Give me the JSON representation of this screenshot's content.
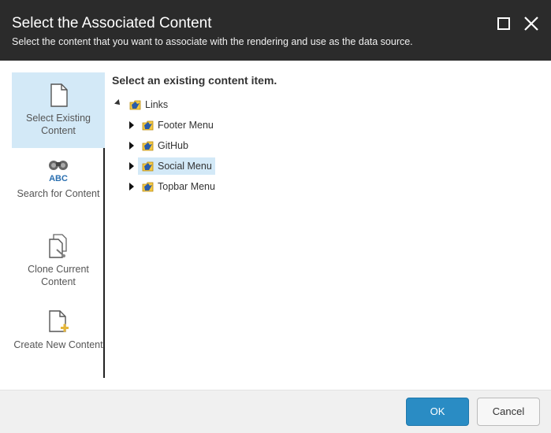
{
  "dialog": {
    "title": "Select the Associated Content",
    "subtitle": "Select the content that you want to associate with the rendering and use as the data source.",
    "window_controls": [
      "maximize-icon",
      "close-icon"
    ]
  },
  "sidebar": {
    "items": [
      {
        "label": "Select Existing Content",
        "icon": "document-icon",
        "selected": true
      },
      {
        "label": "Search for Content",
        "icon": "binoculars-abc-icon",
        "selected": false
      },
      {
        "label": "Clone Current Content",
        "icon": "clone-document-icon",
        "selected": false
      },
      {
        "label": "Create New Content",
        "icon": "new-document-icon",
        "selected": false
      }
    ]
  },
  "main": {
    "heading": "Select an existing content item.",
    "tree": {
      "root": {
        "label": "Links",
        "expanded": true
      },
      "children": [
        {
          "label": "Footer Menu",
          "expanded": false,
          "selected": false
        },
        {
          "label": "GitHub",
          "expanded": false,
          "selected": false
        },
        {
          "label": "Social Menu",
          "expanded": false,
          "selected": true
        },
        {
          "label": "Topbar Menu",
          "expanded": false,
          "selected": false
        }
      ]
    }
  },
  "footer": {
    "ok_label": "OK",
    "cancel_label": "Cancel"
  },
  "colors": {
    "header_bg": "#2b2b2b",
    "selection_bg": "#d3e9f7",
    "primary_button": "#2a8cc4",
    "footer_bg": "#f0f0f0"
  }
}
